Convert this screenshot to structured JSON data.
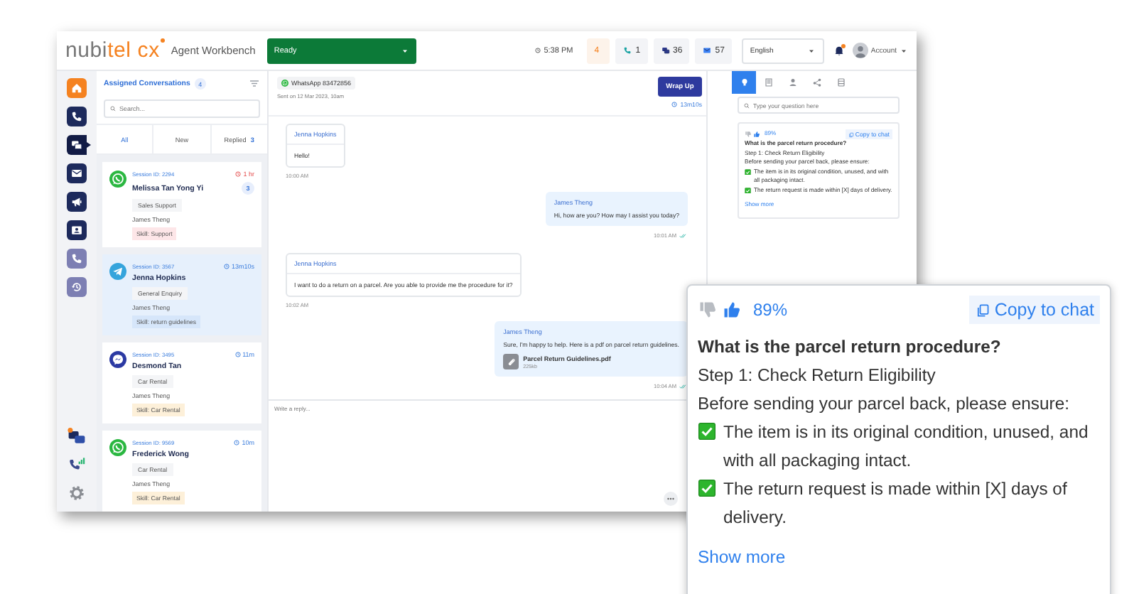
{
  "header": {
    "logo": {
      "main": "nubi",
      "accent": "tel cx"
    },
    "app_name": "Agent Workbench",
    "status": "Ready",
    "time": "5:38 PM",
    "counters": [
      {
        "kind": "queue",
        "value": "4"
      },
      {
        "kind": "phone",
        "value": "1"
      },
      {
        "kind": "chat",
        "value": "36"
      },
      {
        "kind": "mail",
        "value": "57"
      }
    ],
    "language": "English",
    "notification": true,
    "account": "Account"
  },
  "nav": [
    {
      "kind": "home",
      "selected": false,
      "disabled": false
    },
    {
      "kind": "phone",
      "selected": false,
      "disabled": false
    },
    {
      "kind": "chat",
      "selected": true,
      "disabled": false
    },
    {
      "kind": "mail",
      "selected": false,
      "disabled": false
    },
    {
      "kind": "megaphone",
      "selected": false,
      "disabled": false
    },
    {
      "kind": "contact",
      "selected": false,
      "disabled": false
    },
    {
      "kind": "phone",
      "selected": false,
      "disabled": true
    },
    {
      "kind": "history",
      "selected": false,
      "disabled": true
    }
  ],
  "nav_bottom": [
    {
      "kind": "chats"
    },
    {
      "kind": "signal"
    },
    {
      "kind": "gear"
    }
  ],
  "conversations": {
    "title": "Assigned Conversations",
    "count": "4",
    "search_placeholder": "Search...",
    "tabs": [
      {
        "label": "All",
        "selected": true
      },
      {
        "label": "New",
        "selected": false
      },
      {
        "label": "Replied",
        "count": "3",
        "selected": false
      }
    ],
    "items": [
      {
        "kind": "whatsapp",
        "session": "Session ID: 2294",
        "time": "1 hr",
        "overdue": true,
        "name": "Melissa Tan Yong Yi",
        "unread": "3",
        "topic": "Sales Support",
        "agent": "James Theng",
        "skill": "Skill: Support",
        "color": "#fde6e8",
        "selected": false
      },
      {
        "kind": "telegram",
        "session": "Session ID: 3567",
        "time": "13m10s",
        "overdue": false,
        "name": "Jenna Hopkins",
        "topic": "General Enquiry",
        "agent": "James Theng",
        "skill": "Skill: return guidelines",
        "color": "#d6e6fa",
        "selected": true
      },
      {
        "kind": "messenger",
        "session": "Session ID: 3495",
        "time": "11m",
        "overdue": false,
        "name": "Desmond Tan",
        "topic": "Car Rental",
        "agent": "James Theng",
        "skill": "Skill: Car Rental",
        "color": "#fdf0d9",
        "selected": false
      },
      {
        "kind": "whatsapp",
        "session": "Session ID: 9569",
        "time": "10m",
        "overdue": false,
        "name": "Frederick Wong",
        "topic": "Car Rental",
        "agent": "James Theng",
        "skill": "Skill: Car Rental",
        "color": "#fdf0d9",
        "selected": false
      }
    ]
  },
  "chat": {
    "channel_label": "WhatsApp 83472856",
    "sent": "Sent on 12 Mar 2023, 10am",
    "wrap_up": "Wrap Up",
    "timer": "13m10s",
    "messages": [
      {
        "kind": "incoming",
        "sender": "Jenna Hopkins",
        "text": "Hello!",
        "time": "10:00 AM",
        "read": false
      },
      {
        "kind": "outgoing",
        "sender": "James Theng",
        "text": "Hi, how are you? How may I assist you today?",
        "time": "10:01 AM",
        "read": true
      },
      {
        "kind": "incoming",
        "sender": "Jenna Hopkins",
        "text": "I want to do a return on a parcel. Are you able to provide me the procedure for it?",
        "time": "10:02 AM",
        "read": false
      },
      {
        "kind": "outgoing",
        "sender": "James Theng",
        "text": "Sure, I'm happy to help. Here is a pdf on parcel return guidelines.",
        "attachment": {
          "name": "Parcel Return Guidelines.pdf",
          "size": "225kb"
        },
        "time": "10:04 AM",
        "read": true
      }
    ],
    "reply_placeholder": "Write a reply..."
  },
  "assistant": {
    "tabs": [
      {
        "kind": "bulb",
        "selected": true
      },
      {
        "kind": "book",
        "selected": false
      },
      {
        "kind": "person",
        "selected": false
      },
      {
        "kind": "share",
        "selected": false
      },
      {
        "kind": "database",
        "selected": false
      }
    ],
    "search_placeholder": "Type your question here",
    "answer": {
      "liked": true,
      "confidence": "89%",
      "copy": "Copy to chat",
      "question": "What is the parcel return procedure?",
      "lines": [
        {
          "kind": "text",
          "text": "Step 1: Check Return Eligibility"
        },
        {
          "kind": "text",
          "text": "Before sending your parcel back, please ensure:"
        },
        {
          "kind": "check",
          "text": "The item is in its original condition, unused, and with all packaging intact."
        },
        {
          "kind": "check",
          "text": "The return request is made within [X] days of delivery."
        }
      ],
      "show_more": "Show more"
    }
  },
  "callout": {
    "liked": true,
    "confidence": "89%",
    "copy": "Copy to chat",
    "question": "What is the parcel return procedure?",
    "lines": [
      {
        "kind": "text",
        "text": "Step 1: Check Return Eligibility"
      },
      {
        "kind": "text",
        "text": "Before sending your parcel back, please ensure:"
      },
      {
        "kind": "check",
        "text": "The item is in its original condition, unused, and with all packaging intact."
      },
      {
        "kind": "check",
        "text": "The return request is made within [X] days of delivery."
      }
    ],
    "show_more": "Show more"
  }
}
